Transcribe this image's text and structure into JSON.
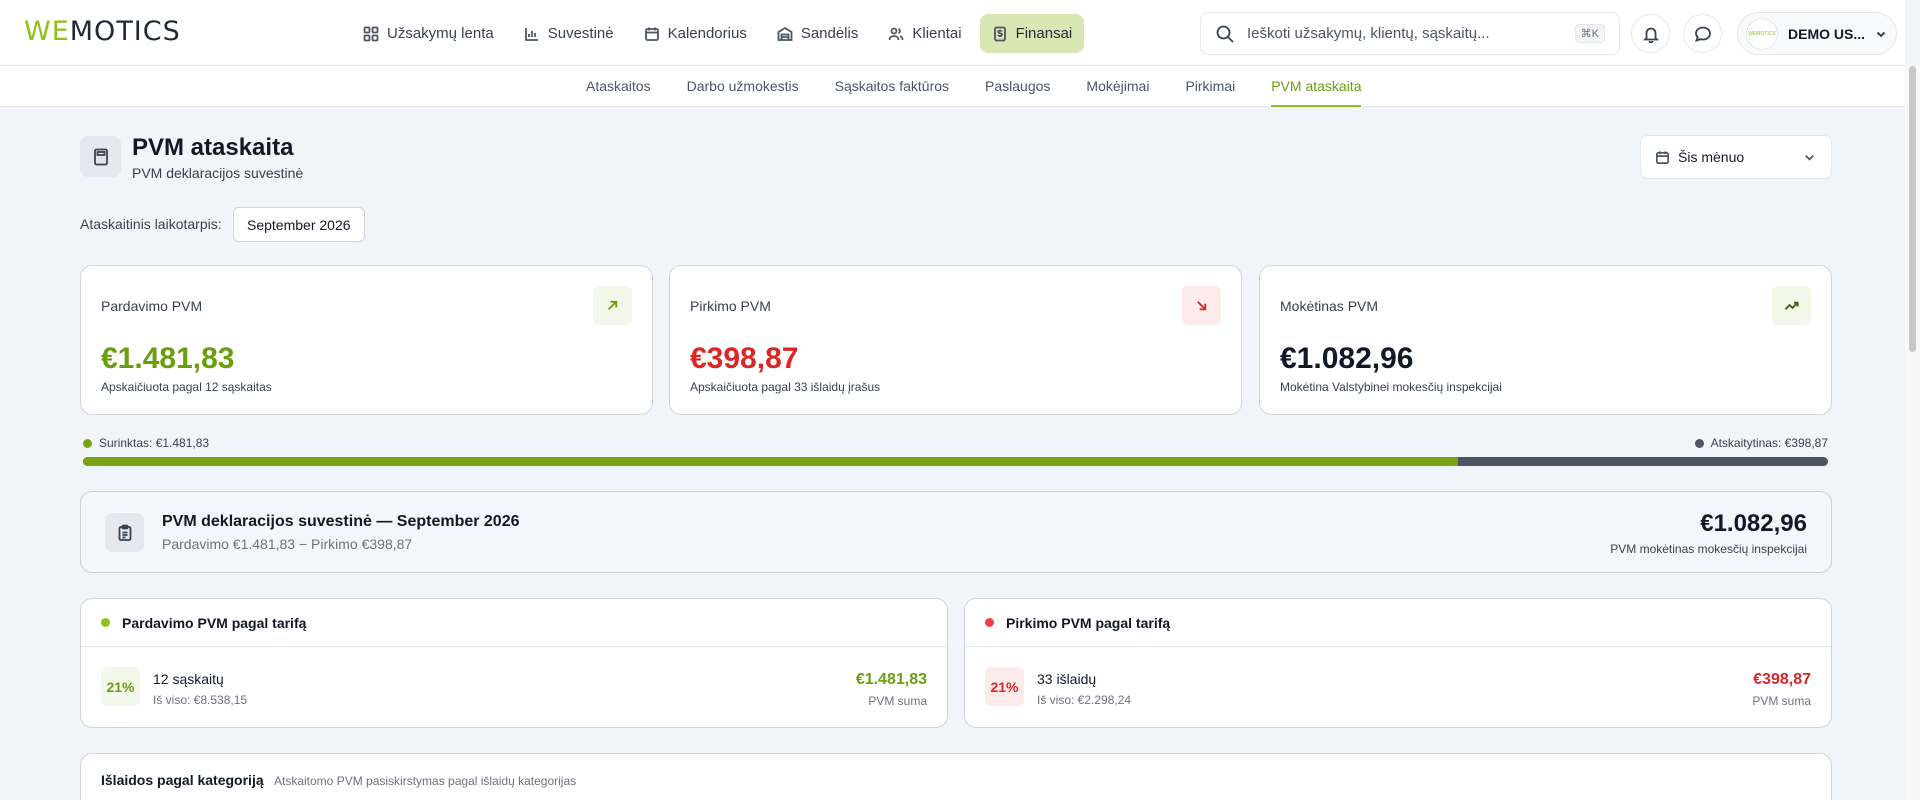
{
  "brand": {
    "logo_left": "WE",
    "logo_right": "MOTICS",
    "accent": "#8cc21a"
  },
  "nav": [
    {
      "label": "Užsakymų lenta",
      "icon": "dashboard-icon"
    },
    {
      "label": "Suvestinė",
      "icon": "bar-chart-icon"
    },
    {
      "label": "Kalendorius",
      "icon": "calendar-icon"
    },
    {
      "label": "Sandėlis",
      "icon": "warehouse-icon"
    },
    {
      "label": "Klientai",
      "icon": "users-icon"
    },
    {
      "label": "Finansai",
      "icon": "finance-icon",
      "active": true
    }
  ],
  "search": {
    "placeholder": "Ieškoti užsakymų, klientų, sąskaitų...",
    "shortcut": "⌘K"
  },
  "user": {
    "name": "DEMO US...",
    "avatar_text": "WEMOTICS"
  },
  "subnav": [
    {
      "label": "Ataskaitos"
    },
    {
      "label": "Darbo užmokestis"
    },
    {
      "label": "Sąskaitos faktūros"
    },
    {
      "label": "Paslaugos"
    },
    {
      "label": "Mokėjimai"
    },
    {
      "label": "Pirkimai"
    },
    {
      "label": "PVM ataskaita",
      "active": true
    }
  ],
  "page": {
    "title": "PVM ataskaita",
    "subtitle": "PVM deklaracijos suvestinė",
    "period_select": "Šis mėnuo",
    "period_label": "Ataskaitinis laikotarpis:",
    "period_value": "September 2026"
  },
  "cards": [
    {
      "label": "Pardavimo PVM",
      "value": "€1.481,83",
      "note": "Apskaičiuota pagal 12 sąskaitas",
      "icon": "arrow-up-right-icon",
      "color": "#6a9e0f",
      "badge_bg": "#f4f8ea"
    },
    {
      "label": "Pirkimo PVM",
      "value": "€398,87",
      "note": "Apskaičiuota pagal 33 išlaidų įrašus",
      "icon": "arrow-down-right-icon",
      "color": "#dc2626",
      "badge_bg": "#fdeaea"
    },
    {
      "label": "Mokėtinas PVM",
      "value": "€1.082,96",
      "note": "Mokėtina Valstybinei mokesčių inspekcijai",
      "icon": "trending-up-icon",
      "color": "#111827",
      "badge_bg": "#f4f8ea"
    }
  ],
  "progress": {
    "collected_label": "Surinktas: €1.481,83",
    "deductible_label": "Atskaitytinas: €398,87",
    "collected_fraction": 0.788,
    "collected_color": "#7aa313",
    "deductible_color": "#4b5563"
  },
  "summary": {
    "title": "PVM deklaracijos suvestinė — September 2026",
    "subtitle": "Pardavimo €1.481,83 − Pirkimo €398,87",
    "amount": "€1.082,96",
    "amount_label": "PVM mokėtinas mokesčių inspekcijai"
  },
  "rates": [
    {
      "title": "Pardavimo PVM pagal tarifą",
      "dot": "#8cc21a",
      "pct": "21%",
      "pct_color": "#6a9e0f",
      "pct_bg": "#f4f8ea",
      "count": "12 sąskaitų",
      "total": "Iš viso: €8.538,15",
      "amount": "€1.481,83",
      "amount_color": "#6a9e0f",
      "amount_label": "PVM suma"
    },
    {
      "title": "Pirkimo PVM pagal tarifą",
      "dot": "#ef4444",
      "pct": "21%",
      "pct_color": "#dc2626",
      "pct_bg": "#fdeaea",
      "count": "33 išlaidų",
      "total": "Iš viso: €2.298,24",
      "amount": "€398,87",
      "amount_color": "#dc2626",
      "amount_label": "PVM suma"
    }
  ],
  "categories": {
    "title": "Išlaidos pagal kategoriją",
    "subtitle": "Atskaitomo PVM pasiskirstymas pagal išlaidų kategorijas"
  }
}
